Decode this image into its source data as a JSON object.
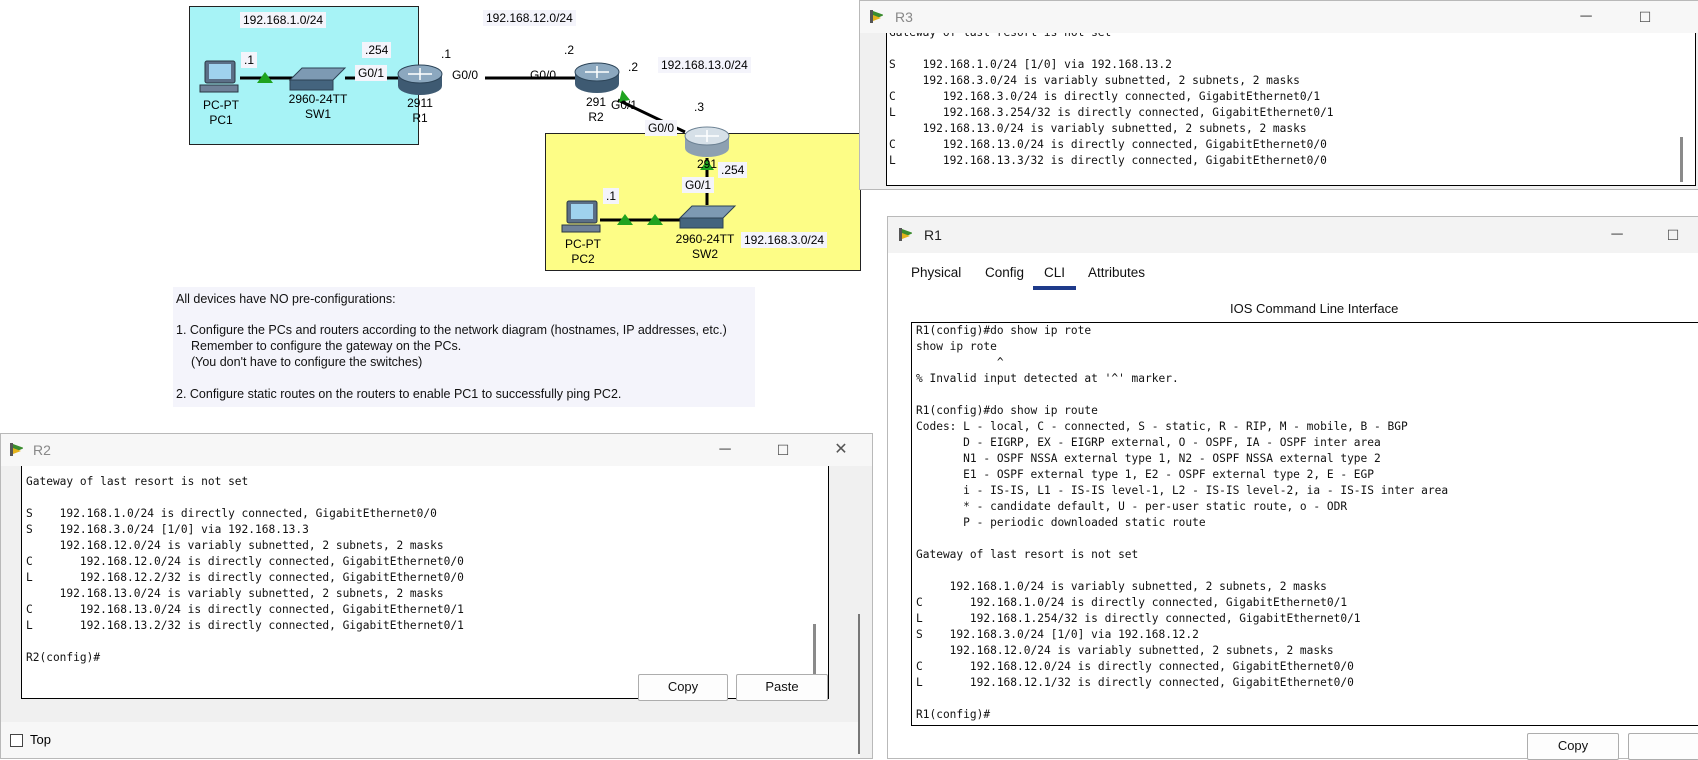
{
  "topology": {
    "nets": {
      "net1": "192.168.1.0/24",
      "net12": "192.168.12.0/24",
      "net13": "192.168.13.0/24",
      "net3": "192.168.3.0/24"
    },
    "devices": {
      "pc1_type": "PC-PT",
      "pc1_name": "PC1",
      "sw1_type": "2960-24TT",
      "sw1_name": "SW1",
      "r1_type": "2911",
      "r1_name": "R1",
      "r2_type": "291",
      "r2_name": "R2",
      "r3_type": "291",
      "pc2_type": "PC-PT",
      "pc2_name": "PC2",
      "sw2_type": "2960-24TT",
      "sw2_name": "SW2"
    },
    "labels": {
      "pc1_ip": ".1",
      "r1_gw": ".254",
      "r1_g01": "G0/1",
      "r1_g00": "G0/0",
      "r1_ip12": ".1",
      "r2_g00": "G0/0",
      "r2_ip12": ".2",
      "r2_g01": "G0/1",
      "r2_ip13": ".2",
      "r3_ip13": ".3",
      "r3_g00": "G0/0",
      "r3_gw": ".254",
      "r3_g01": "G0/1",
      "pc2_ip": ".1"
    }
  },
  "instructions": {
    "intro": "All devices have NO pre-configurations:",
    "step1": "1. Configure the PCs and routers according to the network diagram (hostnames, IP addresses, etc.)",
    "step1b": "Remember to configure the gateway on the PCs.",
    "step1c": "(You don't have to configure the switches)",
    "step2": "2. Configure static routes on the routers to enable PC1 to successfully ping PC2."
  },
  "r3_window": {
    "title": "R3",
    "output": "Gateway of last resort is not set\n\nS    192.168.1.0/24 [1/0] via 192.168.13.2\n     192.168.3.0/24 is variably subnetted, 2 subnets, 2 masks\nC       192.168.3.0/24 is directly connected, GigabitEthernet0/1\nL       192.168.3.254/32 is directly connected, GigabitEthernet0/1\n     192.168.13.0/24 is variably subnetted, 2 subnets, 2 masks\nC       192.168.13.0/24 is directly connected, GigabitEthernet0/0\nL       192.168.13.3/32 is directly connected, GigabitEthernet0/0"
  },
  "r2_window": {
    "title": "R2",
    "output": "Gateway of last resort is not set\n\nS    192.168.1.0/24 is directly connected, GigabitEthernet0/0\nS    192.168.3.0/24 [1/0] via 192.168.13.3\n     192.168.12.0/24 is variably subnetted, 2 subnets, 2 masks\nC       192.168.12.0/24 is directly connected, GigabitEthernet0/0\nL       192.168.12.2/32 is directly connected, GigabitEthernet0/0\n     192.168.13.0/24 is variably subnetted, 2 subnets, 2 masks\nC       192.168.13.0/24 is directly connected, GigabitEthernet0/1\nL       192.168.13.2/32 is directly connected, GigabitEthernet0/1\n\nR2(config)#",
    "copy_label": "Copy",
    "paste_label": "Paste",
    "top_label": "Top"
  },
  "r1_window": {
    "title": "R1",
    "tabs": [
      "Physical",
      "Config",
      "CLI",
      "Attributes"
    ],
    "active_tab": "CLI",
    "cli_header": "IOS Command Line Interface",
    "output": "R1(config)#do show ip rote\nshow ip rote\n            ^\n% Invalid input detected at '^' marker.\n\nR1(config)#do show ip route\nCodes: L - local, C - connected, S - static, R - RIP, M - mobile, B - BGP\n       D - EIGRP, EX - EIGRP external, O - OSPF, IA - OSPF inter area\n       N1 - OSPF NSSA external type 1, N2 - OSPF NSSA external type 2\n       E1 - OSPF external type 1, E2 - OSPF external type 2, E - EGP\n       i - IS-IS, L1 - IS-IS level-1, L2 - IS-IS level-2, ia - IS-IS inter area\n       * - candidate default, U - per-user static route, o - ODR\n       P - periodic downloaded static route\n\nGateway of last resort is not set\n\n     192.168.1.0/24 is variably subnetted, 2 subnets, 2 masks\nC       192.168.1.0/24 is directly connected, GigabitEthernet0/1\nL       192.168.1.254/32 is directly connected, GigabitEthernet0/1\nS    192.168.3.0/24 [1/0] via 192.168.12.2\n     192.168.12.0/24 is variably subnetted, 2 subnets, 2 masks\nC       192.168.12.0/24 is directly connected, GigabitEthernet0/0\nL       192.168.12.1/32 is directly connected, GigabitEthernet0/0\n\nR1(config)#",
    "copy_label": "Copy"
  },
  "colors": {
    "lan1_bg": "#a7f3f6",
    "lan2_bg": "#fdfd86",
    "link_up": "#1fa31f",
    "active_tab_underline": "#1e3a8a"
  }
}
